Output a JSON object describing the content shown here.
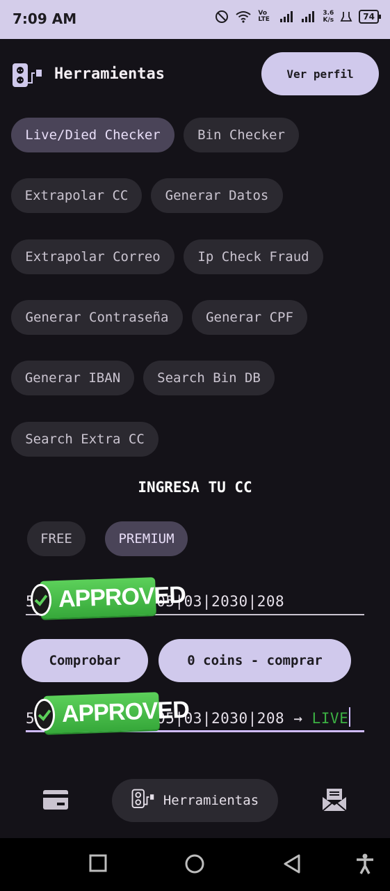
{
  "status_bar": {
    "time": "7:09 AM",
    "network_speed_value": "3.6",
    "network_speed_unit": "K/s",
    "lte_label": "Vo LTE",
    "battery": "74",
    "icons": [
      "do-not-disturb-icon",
      "wifi-icon",
      "signal-icon",
      "signal-icon",
      "usb-debug-icon",
      "battery-icon"
    ]
  },
  "header": {
    "title": "Herramientas",
    "profile_button": "Ver perfil",
    "icon": "tools-icon"
  },
  "tools": [
    {
      "label": "Live/Died Checker",
      "selected": true
    },
    {
      "label": "Bin Checker",
      "selected": false
    },
    {
      "label": "Extrapolar CC",
      "selected": false
    },
    {
      "label": "Generar Datos",
      "selected": false
    },
    {
      "label": "Extrapolar Correo",
      "selected": false
    },
    {
      "label": "Ip Check Fraud",
      "selected": false
    },
    {
      "label": "Generar Contraseña",
      "selected": false
    },
    {
      "label": "Generar CPF",
      "selected": false
    },
    {
      "label": "Generar IBAN",
      "selected": false
    },
    {
      "label": "Search Bin DB",
      "selected": false
    },
    {
      "label": "Search Extra CC",
      "selected": false
    }
  ],
  "checker": {
    "section_title": "INGRESA TU CC",
    "modes": [
      {
        "label": "FREE",
        "selected": false
      },
      {
        "label": "PREMIUM",
        "selected": true
      }
    ],
    "input": {
      "prefix": "5",
      "value_visible": "05|03|2030|208"
    },
    "badge_text": "APPROVED",
    "check_button": "Comprobar",
    "coins_button": "0 coins - comprar",
    "result": {
      "prefix": "5",
      "value_visible": "05|03|2030|208",
      "arrow": "→",
      "status": "LIVE"
    },
    "colors": {
      "accent": "#d0c9ec",
      "live": "#3cb043",
      "badge": "#4cc24c"
    }
  },
  "bottom_nav": {
    "items": [
      {
        "icon": "credit-card-icon",
        "label": ""
      },
      {
        "icon": "tools-icon",
        "label": "Herramientas",
        "active": true
      },
      {
        "icon": "mail-icon",
        "label": ""
      }
    ]
  },
  "system_nav": [
    "recents-icon",
    "home-icon",
    "back-icon",
    "accessibility-icon"
  ]
}
